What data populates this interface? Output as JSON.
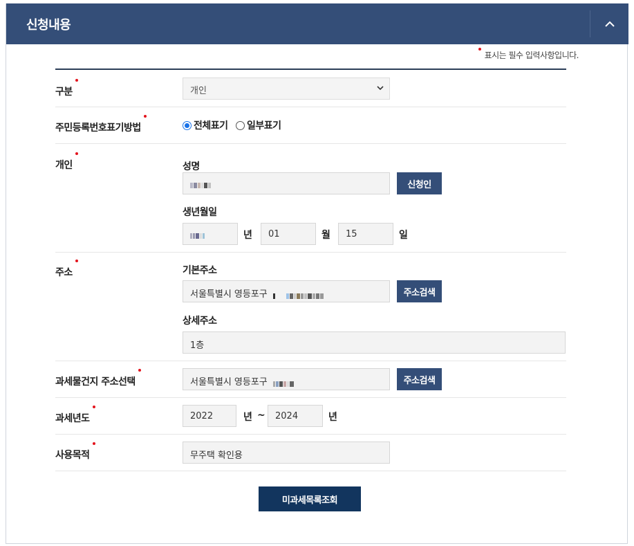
{
  "header": {
    "title": "신청내용"
  },
  "required_note": "표시는 필수 입력사항입니다.",
  "colors": {
    "header_bg": "#344e78",
    "button_bg": "#344e78",
    "submit_bg": "#12355e",
    "required_dot": "#e3141d"
  },
  "fields": {
    "type": {
      "label": "구분",
      "selected": "개인"
    },
    "rrn_display": {
      "label": "주민등록번호표기방법",
      "options": [
        "전체표기",
        "일부표기"
      ],
      "selected": "전체표기"
    },
    "person": {
      "label": "개인",
      "name_label": "성명",
      "name_button": "신청인",
      "birth_label": "생년월일",
      "birth_month": "01",
      "birth_day": "15",
      "unit_year": "년",
      "unit_month": "월",
      "unit_day": "일"
    },
    "address": {
      "label": "주소",
      "basic_label": "기본주소",
      "basic_value": "서울특별시 영등포구",
      "search_button": "주소검색",
      "detail_label": "상세주소",
      "detail_value": "1층"
    },
    "tax_address": {
      "label": "과세물건지 주소선택",
      "value": "서울특별시 영등포구",
      "search_button": "주소검색"
    },
    "tax_year": {
      "label": "과세년도",
      "from": "2022",
      "to": "2024",
      "unit": "년",
      "separator": "~"
    },
    "purpose": {
      "label": "사용목적",
      "value": "무주택 확인용"
    }
  },
  "submit_label": "미과세목록조회"
}
